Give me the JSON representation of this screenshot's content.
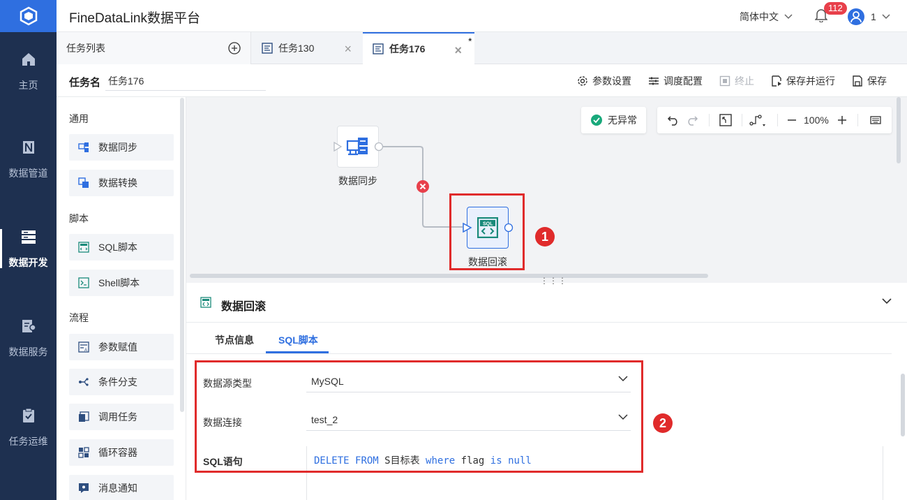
{
  "header": {
    "app_title": "FineDataLink数据平台",
    "language": "简体中文",
    "notification_count": "112",
    "user_name": "1"
  },
  "nav": {
    "items": [
      {
        "label": "主页",
        "icon": "home-icon"
      },
      {
        "label": "数据管道",
        "icon": "pipeline-icon"
      },
      {
        "label": "数据开发",
        "icon": "dev-icon",
        "active": true
      },
      {
        "label": "数据服务",
        "icon": "service-icon"
      },
      {
        "label": "任务运维",
        "icon": "ops-icon"
      }
    ]
  },
  "tabs": {
    "task_list_label": "任务列表",
    "items": [
      {
        "label": "任务130"
      },
      {
        "label": "任务176",
        "active": true,
        "dirty_mark": "*"
      }
    ]
  },
  "taskbar": {
    "name_label": "任务名",
    "name_value": "任务176",
    "buttons": {
      "params": "参数设置",
      "schedule": "调度配置",
      "stop": "终止",
      "save_run": "保存并运行",
      "save": "保存"
    }
  },
  "palette": {
    "sections": [
      {
        "title": "通用",
        "items": [
          "数据同步",
          "数据转换"
        ]
      },
      {
        "title": "脚本",
        "items": [
          "SQL脚本",
          "Shell脚本"
        ]
      },
      {
        "title": "流程",
        "items": [
          "参数赋值",
          "条件分支",
          "调用任务",
          "循环容器",
          "消息通知"
        ]
      }
    ]
  },
  "canvas": {
    "status": "无异常",
    "zoom": "100%",
    "nodes": [
      {
        "label": "数据同步"
      },
      {
        "label": "数据回滚"
      }
    ],
    "callouts": [
      "1",
      "2"
    ]
  },
  "panel": {
    "title": "数据回滚",
    "tabs": [
      "节点信息",
      "SQL脚本"
    ],
    "active_tab": "SQL脚本",
    "fields": {
      "datasource_type_label": "数据源类型",
      "datasource_type_value": "MySQL",
      "connection_label": "数据连接",
      "connection_value": "test_2",
      "sql_label": "SQL语句"
    },
    "sql": {
      "kw1": "DELETE",
      "kw2": "FROM",
      "table": "S目标表",
      "kw3": "where",
      "col": "flag",
      "kw4": "is",
      "kw5": "null"
    }
  },
  "colors": {
    "nav_bg": "#1e3050",
    "accent": "#2f6fe0",
    "highlight": "#e02b2b",
    "canvas_bg": "#f2f3f5"
  }
}
